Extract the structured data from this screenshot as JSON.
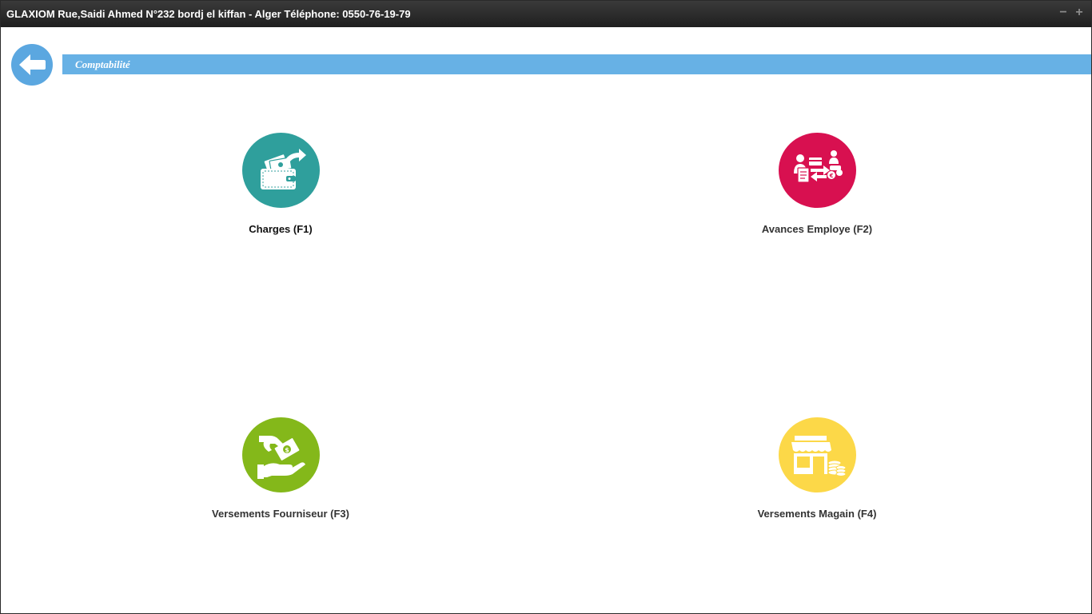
{
  "window": {
    "title": "GLAXIOM Rue,Saidi Ahmed N°232 bordj el kiffan - Alger Téléphone: 0550-76-19-79",
    "minimize_symbol": "−",
    "maximize_symbol": "+"
  },
  "header": {
    "back_icon": "arrow-left-icon",
    "section_title": "Comptabilité",
    "bar_color": "#67b1e5"
  },
  "tiles": [
    {
      "label": "Charges (F1)",
      "icon": "wallet-money-icon",
      "color": "#2f9f9c"
    },
    {
      "label": "Avances Employe (F2)",
      "icon": "employee-advance-icon",
      "color": "#d81050"
    },
    {
      "label": "Versements Fourniseur (F3)",
      "icon": "hand-money-icon",
      "color": "#84b81a"
    },
    {
      "label": "Versements Magain (F4)",
      "icon": "store-coins-icon",
      "color": "#fcd848"
    }
  ]
}
